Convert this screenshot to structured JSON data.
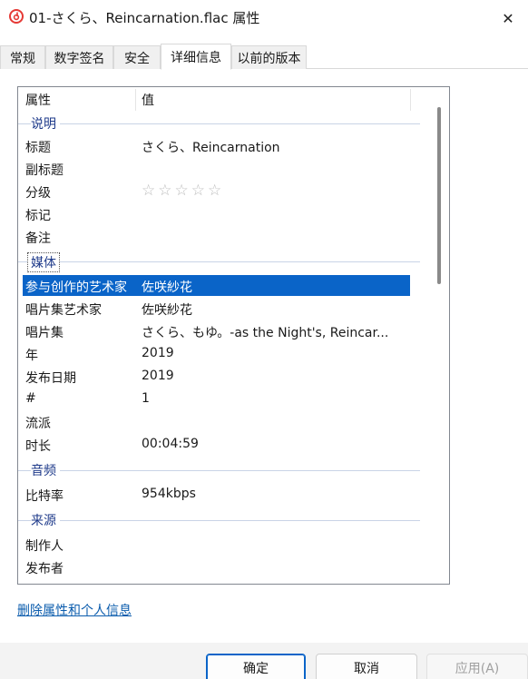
{
  "window": {
    "title": "01-さくら、Reincarnation.flac 属性",
    "close_glyph": "✕"
  },
  "tabs": [
    {
      "label": "常规"
    },
    {
      "label": "数字签名"
    },
    {
      "label": "安全"
    },
    {
      "label": "详细信息",
      "active": true
    },
    {
      "label": "以前的版本"
    }
  ],
  "list": {
    "columns": {
      "property": "属性",
      "value": "值"
    },
    "groups": {
      "description": "说明",
      "media": "媒体",
      "audio": "音频",
      "source": "来源"
    },
    "rows": [
      {
        "key": "标题",
        "value": "さくら、Reincarnation"
      },
      {
        "key": "副标题",
        "value": ""
      },
      {
        "key": "分级",
        "value": "☆☆☆☆☆",
        "rating": 0
      },
      {
        "key": "标记",
        "value": ""
      },
      {
        "key": "备注",
        "value": ""
      },
      {
        "key": "参与创作的艺术家",
        "value": "佐咲紗花",
        "selected": true
      },
      {
        "key": "唱片集艺术家",
        "value": "佐咲紗花"
      },
      {
        "key": "唱片集",
        "value": "さくら、もゆ。-as the Night's, Reincar..."
      },
      {
        "key": "年",
        "value": "2019"
      },
      {
        "key": "发布日期",
        "value": "2019"
      },
      {
        "key": "#",
        "value": "1"
      },
      {
        "key": "流派",
        "value": ""
      },
      {
        "key": "时长",
        "value": "00:04:59"
      },
      {
        "key": "比特率",
        "value": "954kbps"
      },
      {
        "key": "制作人",
        "value": ""
      },
      {
        "key": "发布者",
        "value": ""
      }
    ]
  },
  "link": {
    "label": "删除属性和个人信息"
  },
  "buttons": {
    "ok": "确定",
    "cancel": "取消",
    "apply": "应用(A)"
  },
  "colors": {
    "accent": "#0a64c8",
    "group_text": "#1e3a8a",
    "link": "#0b5cad"
  }
}
